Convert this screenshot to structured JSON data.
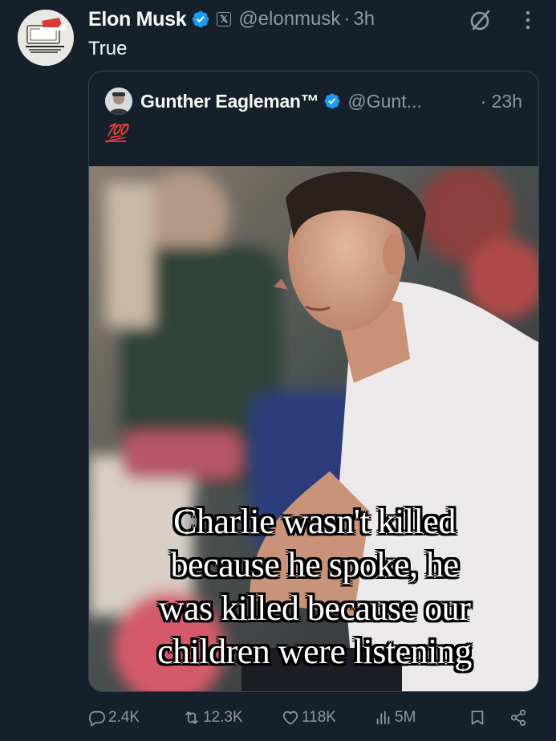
{
  "post": {
    "author_name": "Elon Musk",
    "author_handle": "@elonmusk",
    "separator": "·",
    "time": "3h",
    "text": "True"
  },
  "quoted_post": {
    "author_name": "Gunther Eagleman™",
    "author_handle": "@Gunt...",
    "time": "· 23h",
    "text": "💯",
    "image_caption": [
      "Charlie wasn't killed",
      "because he spoke, he",
      "was killed because our",
      "children were listening"
    ]
  },
  "actions": {
    "replies": "2.4K",
    "reposts": "12.3K",
    "likes": "118K",
    "views": "5M"
  },
  "icons": {
    "verified": "verified-badge-icon",
    "affiliate": "x-affiliate-badge-icon",
    "grok": "grok-icon",
    "more": "more-icon",
    "reply": "reply-icon",
    "repost": "repost-icon",
    "like": "like-icon",
    "views": "views-icon",
    "bookmark": "bookmark-icon",
    "share": "share-icon"
  },
  "colors": {
    "background": "#15202b",
    "text": "#f7f9f9",
    "muted": "#8b98a5",
    "verified": "#1d9bf0",
    "border": "#38444d"
  }
}
